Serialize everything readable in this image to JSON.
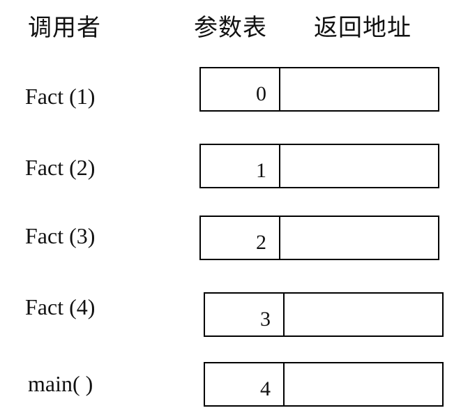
{
  "headers": {
    "caller": "调用者",
    "params": "参数表",
    "return_address": "返回地址"
  },
  "frames": [
    {
      "caller": "Fact (1)",
      "param": "0",
      "return_address": ""
    },
    {
      "caller": "Fact (2)",
      "param": "1",
      "return_address": ""
    },
    {
      "caller": "Fact (3)",
      "param": "2",
      "return_address": ""
    },
    {
      "caller": "Fact (4)",
      "param": "3",
      "return_address": ""
    },
    {
      "caller": "main( )",
      "param": "4",
      "return_address": ""
    }
  ]
}
